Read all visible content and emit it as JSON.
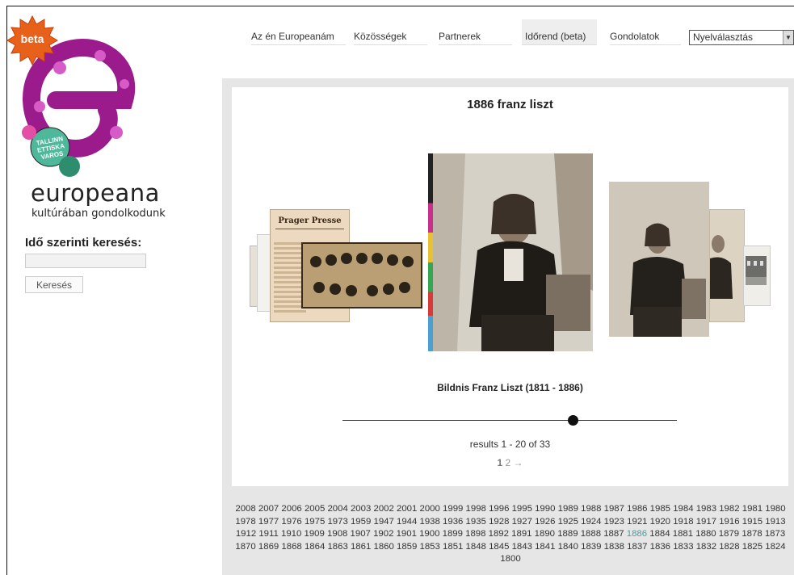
{
  "brand": {
    "badge": "beta",
    "name": "europeana",
    "tagline": "kultúrában gondolkodunk",
    "logo_text": [
      "TALLINN",
      "ETTISKA",
      "VAROS"
    ],
    "colors": {
      "logo": "#9b1a8c",
      "badge": "#e8611a"
    }
  },
  "search": {
    "label": "Idő szerinti keresés:",
    "input_value": "",
    "button_label": "Keresés"
  },
  "nav": {
    "items": [
      {
        "label": "Az én Europeanám"
      },
      {
        "label": "Közösségek"
      },
      {
        "label": "Partnerek"
      },
      {
        "label": "Időrend (beta)"
      },
      {
        "label": "Gondolatok"
      }
    ],
    "language_select": "Nyelválasztás"
  },
  "gallery": {
    "title": "1886 franz liszt",
    "newspaper_headline": "Prager Presse",
    "caption": "Bildnis Franz Liszt (1811 - 1886)",
    "results": "results 1 - 20 of 33",
    "pages": [
      "1",
      "2"
    ],
    "next": "→",
    "slider_position": 0.69
  },
  "years": {
    "current": "1886",
    "list": [
      "2008",
      "2007",
      "2006",
      "2005",
      "2004",
      "2003",
      "2002",
      "2001",
      "2000",
      "1999",
      "1998",
      "1996",
      "1995",
      "1990",
      "1989",
      "1988",
      "1987",
      "1986",
      "1985",
      "1984",
      "1983",
      "1982",
      "1981",
      "1980",
      "1978",
      "1977",
      "1976",
      "1975",
      "1973",
      "1959",
      "1947",
      "1944",
      "1938",
      "1936",
      "1935",
      "1928",
      "1927",
      "1926",
      "1925",
      "1924",
      "1923",
      "1921",
      "1920",
      "1918",
      "1917",
      "1916",
      "1915",
      "1913",
      "1912",
      "1911",
      "1910",
      "1909",
      "1908",
      "1907",
      "1902",
      "1901",
      "1900",
      "1899",
      "1898",
      "1892",
      "1891",
      "1890",
      "1889",
      "1888",
      "1887",
      "1886",
      "1884",
      "1881",
      "1880",
      "1879",
      "1878",
      "1873",
      "1870",
      "1869",
      "1868",
      "1864",
      "1863",
      "1861",
      "1860",
      "1859",
      "1853",
      "1851",
      "1848",
      "1845",
      "1843",
      "1841",
      "1840",
      "1839",
      "1838",
      "1837",
      "1836",
      "1833",
      "1832",
      "1828",
      "1825",
      "1824",
      "1800"
    ]
  }
}
